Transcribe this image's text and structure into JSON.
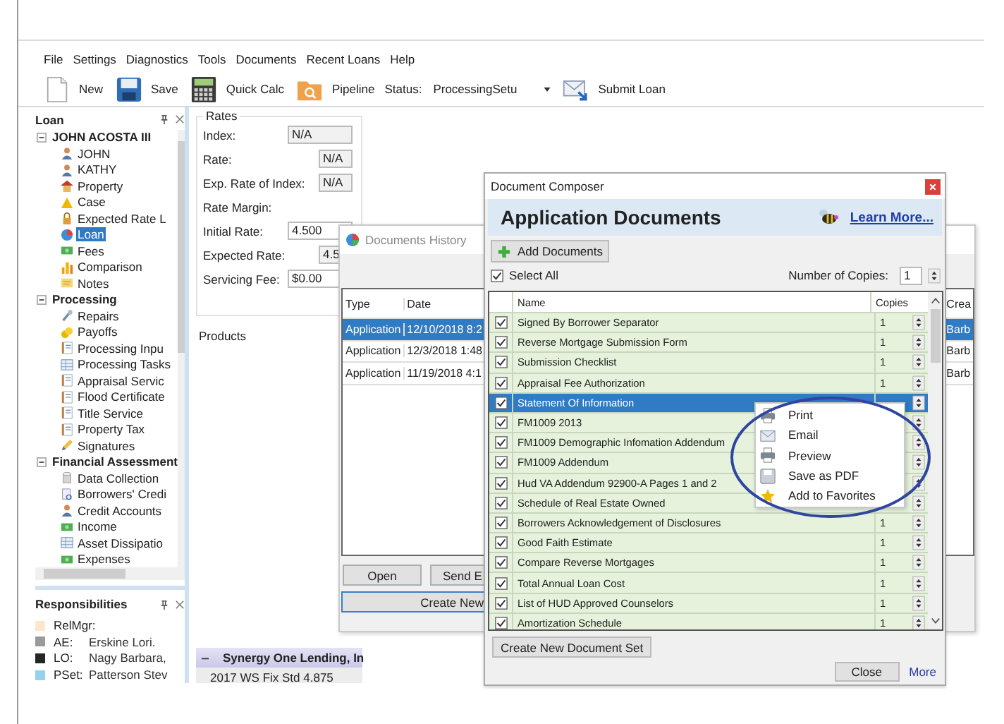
{
  "menu": [
    "File",
    "Settings",
    "Diagnostics",
    "Tools",
    "Documents",
    "Recent Loans",
    "Help"
  ],
  "toolbar": [
    {
      "kind": "button",
      "label": "New"
    },
    {
      "kind": "button",
      "label": "Save"
    },
    {
      "kind": "button",
      "label": "Quick Calc"
    },
    {
      "kind": "button",
      "label": "Pipeline"
    },
    {
      "kind": "status",
      "label": "Status:",
      "value": "ProcessingSetu"
    },
    {
      "kind": "button",
      "label": "Submit Loan"
    }
  ],
  "loan_panel": {
    "title": "Loan",
    "tree": [
      {
        "label": "JOHN ACOSTA III",
        "expanded": true,
        "children": [
          {
            "label": "JOHN",
            "selected": false
          },
          {
            "label": "KATHY",
            "selected": false
          },
          {
            "label": "Property",
            "selected": false
          },
          {
            "label": "Case",
            "selected": false
          },
          {
            "label": "Expected Rate L",
            "selected": false
          },
          {
            "label": "Loan",
            "selected": true
          },
          {
            "label": "Fees",
            "selected": false
          },
          {
            "label": "Comparison",
            "selected": false
          },
          {
            "label": "Notes",
            "selected": false
          }
        ]
      },
      {
        "label": "Processing",
        "expanded": true,
        "children": [
          {
            "label": "Repairs",
            "selected": false
          },
          {
            "label": "Payoffs",
            "selected": false
          },
          {
            "label": "Processing Inpu",
            "selected": false
          },
          {
            "label": "Processing Tasks",
            "selected": false
          },
          {
            "label": "Appraisal Servic",
            "selected": false
          },
          {
            "label": "Flood Certificate",
            "selected": false
          },
          {
            "label": "Title Service",
            "selected": false
          },
          {
            "label": "Property Tax",
            "selected": false
          },
          {
            "label": "Signatures",
            "selected": false
          }
        ]
      },
      {
        "label": "Financial Assessment",
        "expanded": true,
        "children": [
          {
            "label": "Data Collection",
            "selected": false
          },
          {
            "label": "Borrowers' Credi",
            "selected": false
          },
          {
            "label": "Credit Accounts",
            "selected": false
          },
          {
            "label": "Income",
            "selected": false
          },
          {
            "label": "Asset Dissipatio",
            "selected": false
          },
          {
            "label": "Expenses",
            "selected": false
          }
        ]
      }
    ]
  },
  "responsibilities": {
    "title": "Responsibilities",
    "items": [
      {
        "role": "RelMgr:",
        "color": "#fde6cc"
      },
      {
        "role": "AE:",
        "name": "Erskine Lori.",
        "color": "#9a9a9a"
      },
      {
        "role": "LO:",
        "name": "Nagy Barbara,",
        "color": "#262626"
      },
      {
        "role": "PSet:",
        "name": "Patterson Stev",
        "color": "#93d3ec"
      }
    ]
  },
  "rates": {
    "title": "Rates",
    "fields": [
      {
        "kind": "wide",
        "label": "Index:",
        "value": "N/A"
      },
      {
        "kind": "short",
        "label": "Rate:",
        "value": "N/A"
      },
      {
        "kind": "short",
        "label": "Exp. Rate of Index:",
        "value": "N/A"
      },
      {
        "kind": "label",
        "label": "Rate Margin:"
      },
      {
        "kind": "combo",
        "label": "Initial Rate:",
        "value": "4.500"
      },
      {
        "kind": "short",
        "label": "Expected Rate:",
        "value": "4.5"
      },
      {
        "kind": "combo",
        "label": "Servicing Fee:",
        "value": "$0.00"
      }
    ]
  },
  "products": {
    "title": "Products",
    "group": "Synergy One Lending, In",
    "item": "2017 WS Fix Std 4.875"
  },
  "documents_history": {
    "title": "Documents History",
    "columns": [
      "Type",
      "Date",
      "Crea"
    ],
    "rows": [
      {
        "type": "Application",
        "date": "12/10/2018 8:2",
        "creator": "Barb",
        "selected": true
      },
      {
        "type": "Application",
        "date": "12/3/2018 1:48",
        "creator": "Barb",
        "selected": false
      },
      {
        "type": "Application",
        "date": "11/19/2018 4:1",
        "creator": "Barb",
        "selected": false
      }
    ],
    "buttons": [
      "Open",
      "Send E",
      "Create New"
    ]
  },
  "document_composer": {
    "title": "Document Composer",
    "heading": "Application Documents",
    "link": "Learn More...",
    "add_button": "Add Documents",
    "select_all": {
      "label": "Select All",
      "checked": true
    },
    "copies_label": "Number of Copies:",
    "copies": "1",
    "columns": [
      "Name",
      "Copies"
    ],
    "rows": [
      {
        "name": "Signed By Borrower Separator",
        "checked": true,
        "selected": false,
        "copies": "1"
      },
      {
        "name": "Reverse Mortgage Submission Form",
        "checked": true,
        "selected": false,
        "copies": "1"
      },
      {
        "name": "Submission Checklist",
        "checked": true,
        "selected": false,
        "copies": "1"
      },
      {
        "name": "Appraisal Fee Authorization",
        "checked": true,
        "selected": false,
        "copies": "1"
      },
      {
        "name": "Statement Of Information",
        "checked": true,
        "selected": true
      },
      {
        "name": "FM1009 2013",
        "checked": true,
        "selected": false
      },
      {
        "name": "FM1009 Demographic Infomation Addendum",
        "checked": true,
        "selected": false
      },
      {
        "name": "FM1009 Addendum",
        "checked": true,
        "selected": false
      },
      {
        "name": "Hud VA Addendum 92900-A Pages 1 and 2",
        "checked": true,
        "selected": false
      },
      {
        "name": "Schedule of Real Estate Owned",
        "checked": true,
        "selected": false
      },
      {
        "name": "Borrowers Acknowledgement of Disclosures",
        "checked": true,
        "selected": false,
        "copies": "1"
      },
      {
        "name": "Good Faith Estimate",
        "checked": true,
        "selected": false,
        "copies": "1"
      },
      {
        "name": "Compare Reverse Mortgages",
        "checked": true,
        "selected": false,
        "copies": "1"
      },
      {
        "name": "Total Annual Loan Cost",
        "checked": true,
        "selected": false,
        "copies": "1"
      },
      {
        "name": "List of HUD Approved Counselors",
        "checked": true,
        "selected": false,
        "copies": "1"
      },
      {
        "name": "Amortization Schedule",
        "checked": true,
        "selected": false,
        "copies": "1"
      }
    ],
    "new_set_button": "Create New Document Set",
    "close_button": "Close",
    "more_link": "More"
  },
  "context_menu": [
    "Print",
    "Email",
    "Preview",
    "Save as PDF",
    "Add to Favorites"
  ]
}
